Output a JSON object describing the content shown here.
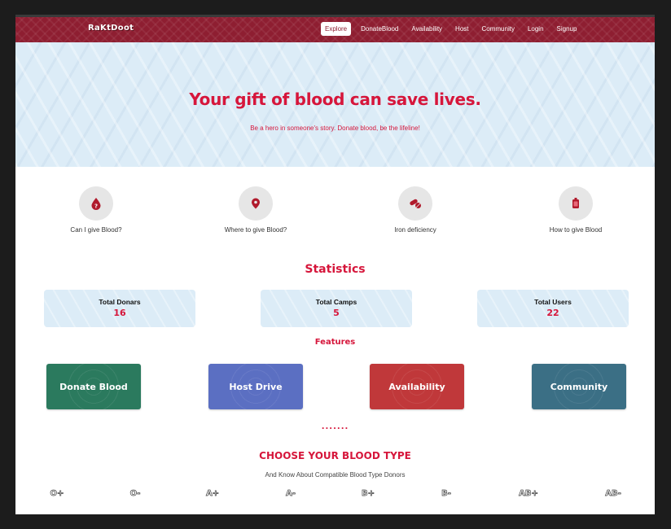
{
  "app": {
    "logo": "RaKtDoot"
  },
  "nav": {
    "items": [
      "Explore",
      "DonateBlood",
      "Availability",
      "Host",
      "Community",
      "Login",
      "Signup"
    ]
  },
  "hero": {
    "title": "Your gift of blood can save lives.",
    "subtitle": "Be a hero in someone's story. Donate blood, be the lifeline!"
  },
  "info": [
    {
      "label": "Can I give Blood?",
      "icon": "blood-drop-question-icon"
    },
    {
      "label": "Where to give Blood?",
      "icon": "map-pin-icon"
    },
    {
      "label": "Iron deficiency",
      "icon": "pill-icon"
    },
    {
      "label": "How to give Blood",
      "icon": "blood-bag-icon"
    }
  ],
  "statistics": {
    "title": "Statistics",
    "cards": [
      {
        "label": "Total Donars",
        "value": "16"
      },
      {
        "label": "Total Camps",
        "value": "5"
      },
      {
        "label": "Total Users",
        "value": "22"
      }
    ]
  },
  "features": {
    "title": "Features",
    "cards": [
      {
        "label": "Donate Blood",
        "color": "#2b7a5e"
      },
      {
        "label": "Host Drive",
        "color": "#5b6fc2"
      },
      {
        "label": "Availability",
        "color": "#c0383a"
      },
      {
        "label": "Community",
        "color": "#3b6f85"
      }
    ]
  },
  "divider": ".......",
  "blood_types": {
    "title": "CHOOSE YOUR BLOOD TYPE",
    "subtitle": "And Know About Compatible Blood Type Donors",
    "types": [
      "O+",
      "O-",
      "A+",
      "A-",
      "B+",
      "B-",
      "AB+",
      "AB-"
    ]
  },
  "colors": {
    "brand": "#8e1e31",
    "accent": "#d6163b",
    "hero_bg": "#dcecf7"
  }
}
